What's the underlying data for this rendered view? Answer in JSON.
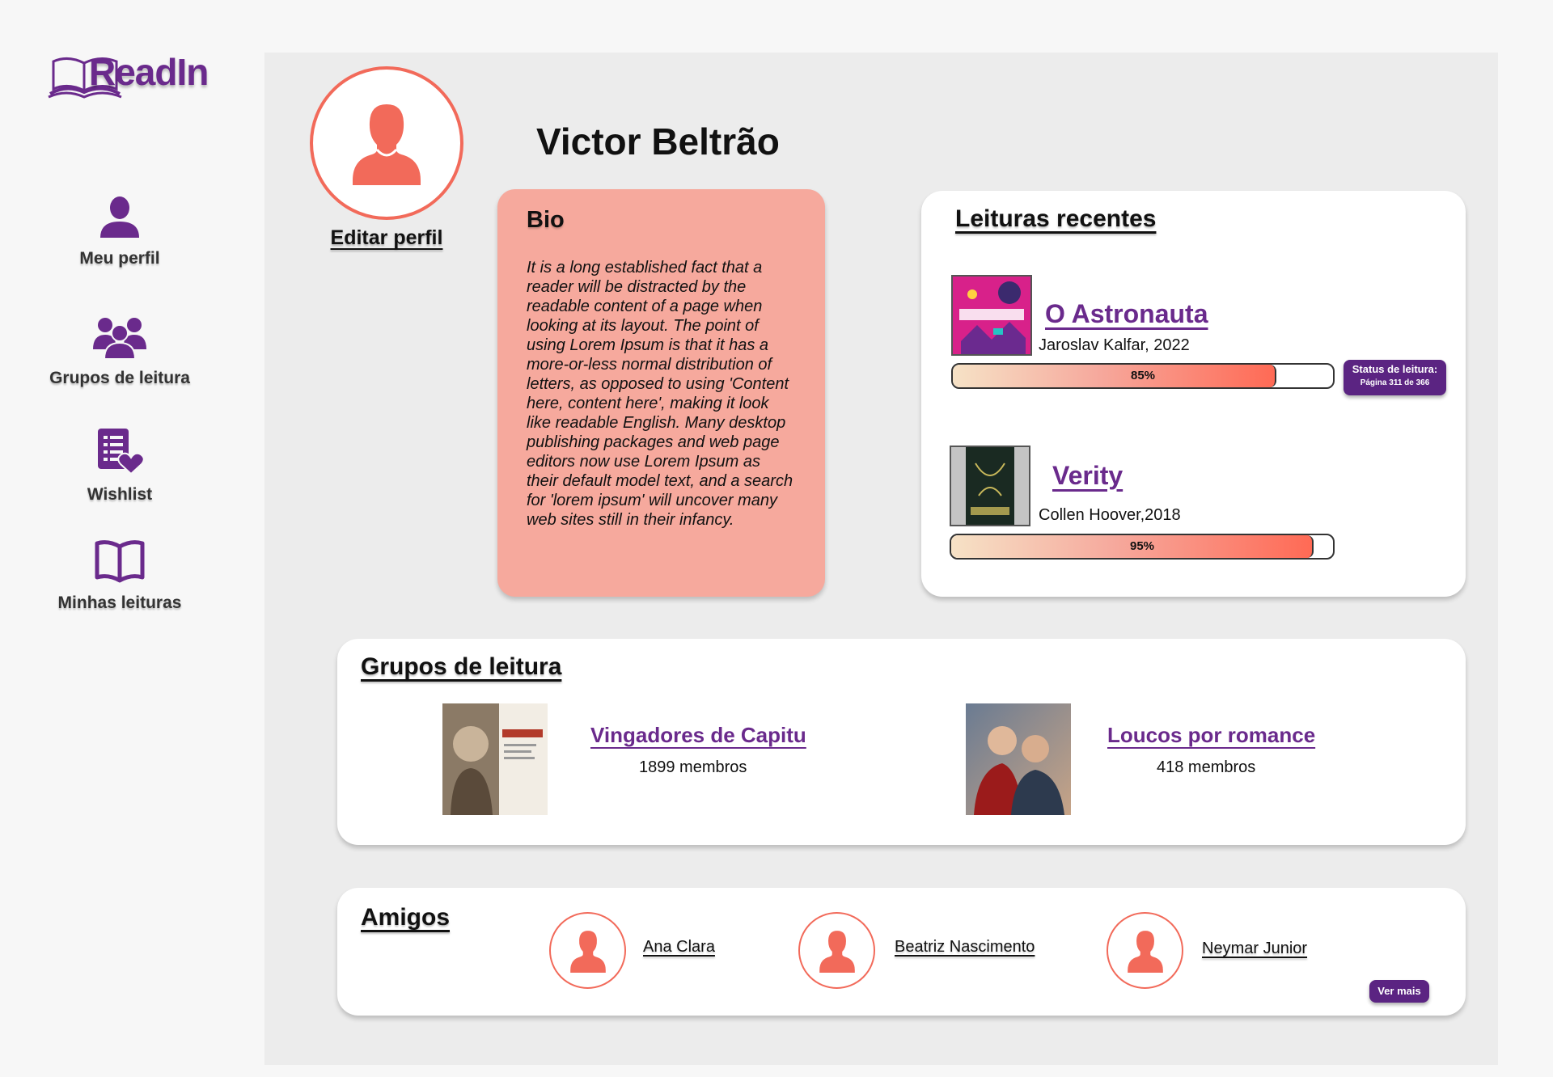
{
  "brand": {
    "logo_text": "ReadIn",
    "accent": "#6a2a8c",
    "coral": "#f26a5a"
  },
  "sidebar": {
    "items": [
      {
        "label": "Meu perfil",
        "icon": "user-icon"
      },
      {
        "label": "Grupos de leitura",
        "icon": "users-icon"
      },
      {
        "label": "Wishlist",
        "icon": "wishlist-icon"
      },
      {
        "label": "Minhas leituras",
        "icon": "book-open-icon"
      }
    ]
  },
  "profile": {
    "name": "Victor Beltrão",
    "edit_label": "Editar perfil"
  },
  "bio": {
    "title": "Bio",
    "text": "It is a long established fact that a reader will be distracted by the readable content of a page when looking at its layout. The point of using Lorem Ipsum is that it has a more-or-less normal distribution of letters, as opposed to using 'Content here, content here', making it look like readable English. Many desktop publishing packages and web page editors now use Lorem Ipsum as their default model text, and a search for 'lorem ipsum' will uncover many web sites still in their infancy."
  },
  "recent": {
    "title": "Leituras recentes",
    "books": [
      {
        "title": "O Astronauta",
        "author": "Jaroslav Kalfar, 2022",
        "progress": 85,
        "progress_label": "85%"
      },
      {
        "title": "Verity",
        "author": "Collen Hoover,2018",
        "progress": 95,
        "progress_label": "95%"
      }
    ],
    "status_title": "Status de leitura:",
    "status_page": "Página 311 de 366"
  },
  "groups": {
    "title": "Grupos de leitura",
    "items": [
      {
        "name": "Vingadores de Capitu",
        "members": "1899 membros"
      },
      {
        "name": "Loucos por romance",
        "members": "418 membros"
      }
    ]
  },
  "friends": {
    "title": "Amigos",
    "items": [
      {
        "name": "Ana Clara"
      },
      {
        "name": "Beatriz Nascimento"
      },
      {
        "name": "Neymar Junior"
      }
    ],
    "see_more": "Ver mais"
  }
}
